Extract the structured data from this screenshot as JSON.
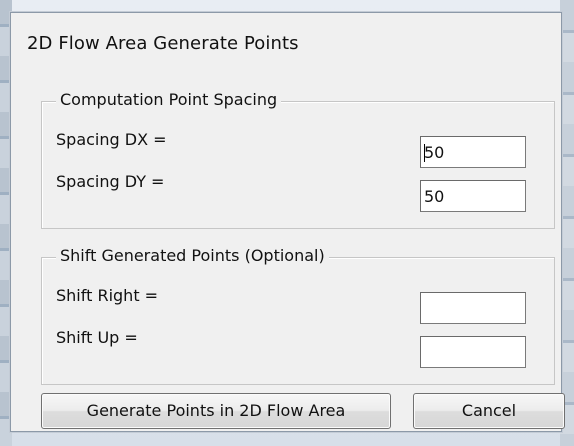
{
  "window": {
    "title": "2D Flow Area Generate Points"
  },
  "spacing_group": {
    "legend": "Computation Point Spacing",
    "dx_label": "Spacing DX =",
    "dx_value": "50",
    "dy_label": "Spacing DY =",
    "dy_value": "50"
  },
  "shift_group": {
    "legend": "Shift Generated Points (Optional)",
    "right_label": "Shift Right =",
    "right_value": "",
    "up_label": "Shift Up =",
    "up_value": ""
  },
  "buttons": {
    "generate_label": "Generate Points in 2D Flow Area",
    "cancel_label": "Cancel"
  }
}
